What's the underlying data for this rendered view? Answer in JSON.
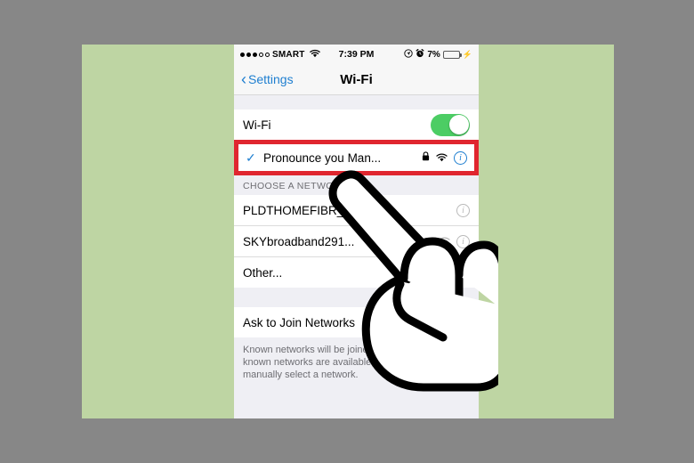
{
  "canvas": {
    "background_color": "#878787",
    "photo_background_color": "#bed5a3"
  },
  "phone": {
    "status_bar": {
      "signal_dots_filled": 3,
      "signal_dots_empty": 2,
      "carrier": "SMART",
      "wifi_icon": "wifi-icon",
      "time": "7:39 PM",
      "location_icon": "location-arrow-icon",
      "alarm_icon": "alarm-clock-icon",
      "battery_percent": "7%",
      "battery_level": 7,
      "battery_color": "#e8433a",
      "charging_icon": "lightning-bolt-icon"
    },
    "nav_bar": {
      "back_icon": "chevron-left-icon",
      "back_label": "Settings",
      "title": "Wi-Fi",
      "tint_color": "#1f7fd0"
    },
    "wifi_toggle_row": {
      "label": "Wi-Fi",
      "toggle_state": "on",
      "toggle_color": "#4ccd64"
    },
    "connected_network": {
      "checkmark": "✓",
      "name": "Pronounce you Man...",
      "lock_icon": "lock-icon",
      "wifi_icon": "wifi-icon",
      "info_icon": "info-circle-icon",
      "highlight_color": "#e0262f"
    },
    "choose_network_section": {
      "header": "CHOOSE A NETWORK...",
      "networks": [
        {
          "name": "PLDTHOMEFIBR_Yoy...",
          "lock_icon": "lock-icon",
          "wifi_icon": "wifi-icon",
          "info_icon": "info-circle-icon"
        },
        {
          "name": "SKYbroadband291...",
          "lock_icon": "lock-icon",
          "wifi_icon": "wifi-icon",
          "info_icon": "info-circle-icon"
        },
        {
          "name": "Other...",
          "lock_icon": "",
          "wifi_icon": "",
          "info_icon": ""
        }
      ]
    },
    "ask_to_join_section": {
      "label": "Ask to Join Networks",
      "footer": "Known networks will be joined automatically. If no known networks are available, you will have to manually select a network."
    },
    "cursor": {
      "type": "pointing-hand-cursor",
      "outline_color": "#000000",
      "fill_color": "#ffffff"
    }
  }
}
